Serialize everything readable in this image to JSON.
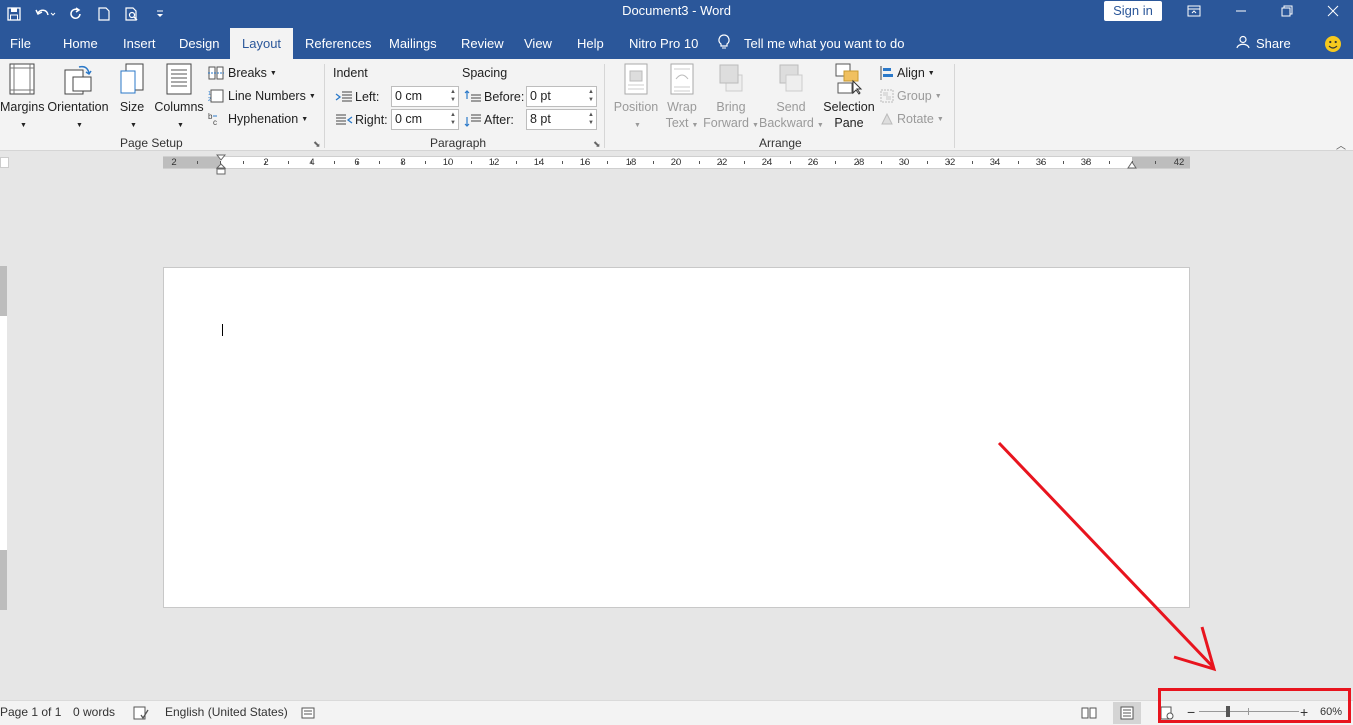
{
  "window": {
    "title": "Document3 - Word",
    "sign_in": "Sign in"
  },
  "tabs": [
    {
      "label": "File"
    },
    {
      "label": "Home"
    },
    {
      "label": "Insert"
    },
    {
      "label": "Design"
    },
    {
      "label": "Layout"
    },
    {
      "label": "References"
    },
    {
      "label": "Mailings"
    },
    {
      "label": "Review"
    },
    {
      "label": "View"
    },
    {
      "label": "Help"
    },
    {
      "label": "Nitro Pro 10"
    }
  ],
  "active_tab": "Layout",
  "tell_me": "Tell me what you want to do",
  "share": "Share",
  "ribbon": {
    "page_setup": {
      "label": "Page Setup",
      "margins": "Margins",
      "orientation": "Orientation",
      "size": "Size",
      "columns": "Columns",
      "breaks": "Breaks",
      "line_numbers": "Line Numbers",
      "hyphenation": "Hyphenation"
    },
    "paragraph": {
      "label": "Paragraph",
      "indent": "Indent",
      "spacing": "Spacing",
      "left_label": "Left:",
      "left_value": "0 cm",
      "right_label": "Right:",
      "right_value": "0 cm",
      "before_label": "Before:",
      "before_value": "0 pt",
      "after_label": "After:",
      "after_value": "8 pt"
    },
    "arrange": {
      "label": "Arrange",
      "position": "Position",
      "wrap_text_1": "Wrap",
      "wrap_text_2": "Text",
      "bring_forward_1": "Bring",
      "bring_forward_2": "Forward",
      "send_backward_1": "Send",
      "send_backward_2": "Backward",
      "selection_pane_1": "Selection",
      "selection_pane_2": "Pane",
      "align": "Align",
      "group": "Group",
      "rotate": "Rotate"
    }
  },
  "ruler": {
    "labels": [
      "2",
      "2",
      "4",
      "6",
      "8",
      "10",
      "12",
      "14",
      "16",
      "18",
      "20",
      "22",
      "24",
      "26",
      "28",
      "30",
      "32",
      "34",
      "36",
      "38",
      "42"
    ]
  },
  "status": {
    "page": "Page 1 of 1",
    "words": "0 words",
    "language": "English (United States)",
    "zoom": "60%"
  },
  "colors": {
    "accent": "#2b579a",
    "annotation": "#e8141e"
  }
}
